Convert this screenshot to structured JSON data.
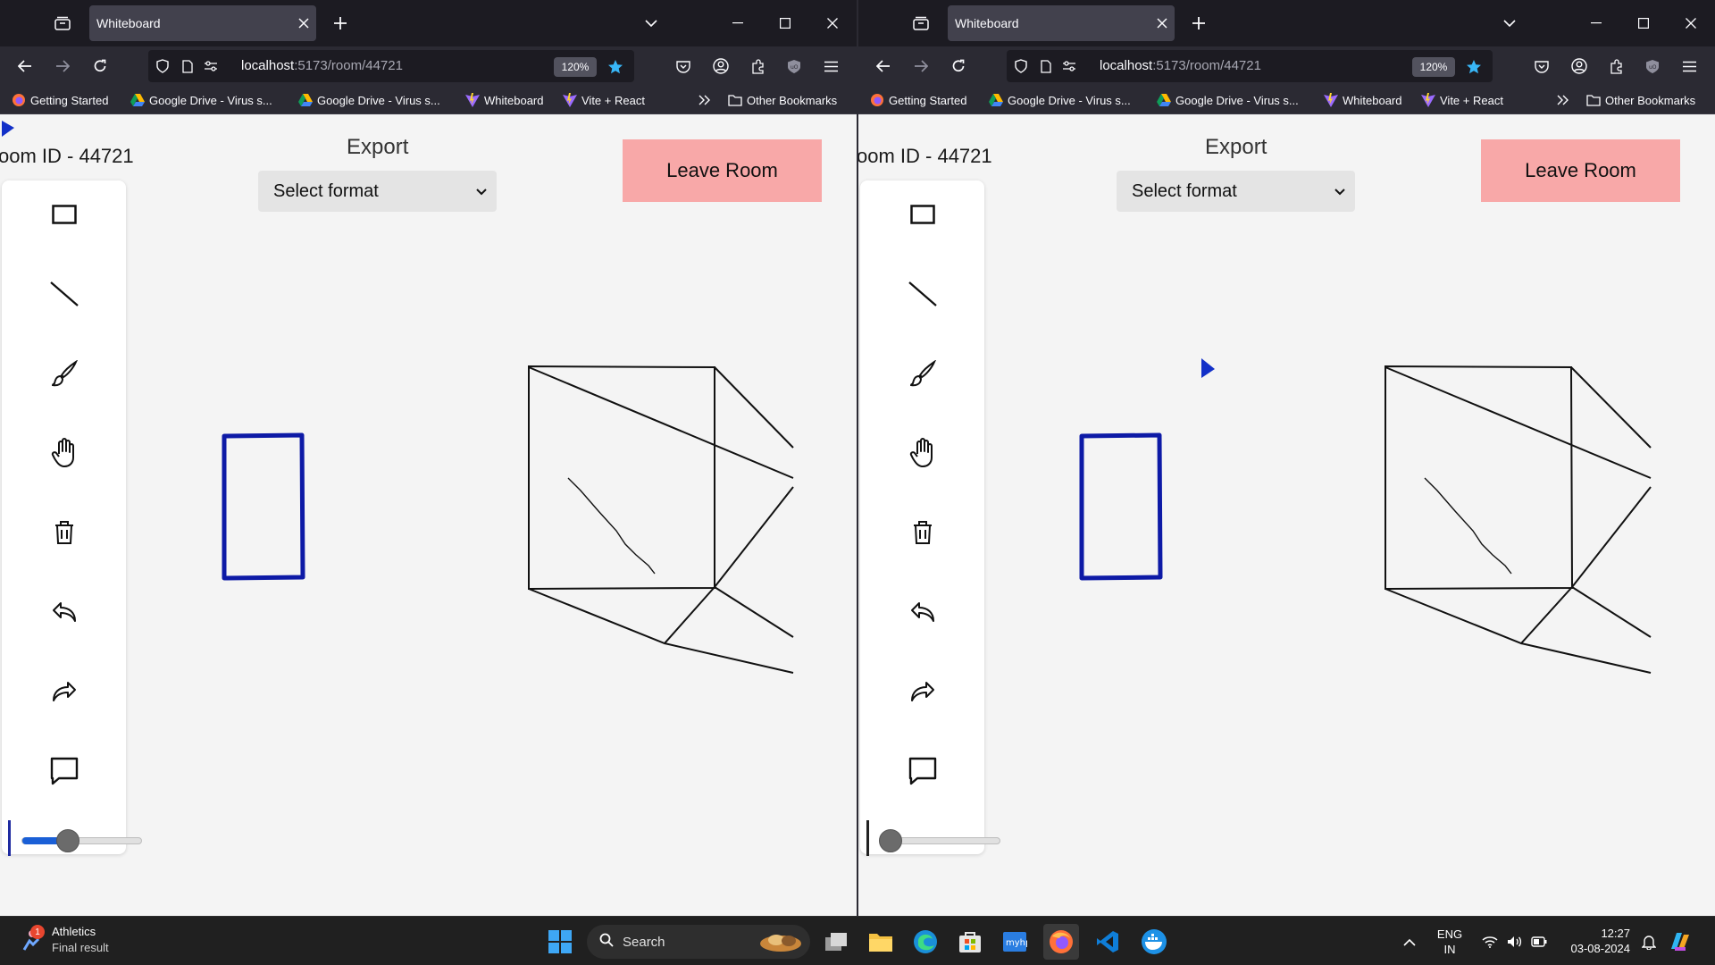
{
  "browser": {
    "tab_title": "Whiteboard",
    "url_host": "localhost",
    "url_path": ":5173/room/44721",
    "zoom": "120%",
    "bookmarks": [
      {
        "label": "Getting Started",
        "icon": "firefox-icon"
      },
      {
        "label": "Google Drive - Virus s...",
        "icon": "google-drive-icon"
      },
      {
        "label": "Google Drive - Virus s...",
        "icon": "google-drive-icon"
      },
      {
        "label": "Whiteboard",
        "icon": "vite-icon"
      },
      {
        "label": "Vite + React",
        "icon": "vite-icon"
      }
    ],
    "other_bookmarks": "Other Bookmarks"
  },
  "app": {
    "room_id": "oom ID - 44721",
    "export_label": "Export",
    "export_select": "Select format",
    "leave_button": "Leave Room",
    "tools": [
      "rectangle-tool",
      "line-tool",
      "brush-tool",
      "hand-tool",
      "delete-tool",
      "undo",
      "redo",
      "chat"
    ],
    "stroke_color": "#1e2aa0",
    "left_slider_fraction": 0.37,
    "right_slider_fraction": 0.0
  },
  "taskbar": {
    "widget_title": "Athletics",
    "widget_sub": "Final result",
    "widget_badge": "1",
    "search_placeholder": "Search",
    "lang_top": "ENG",
    "lang_bottom": "IN",
    "time": "12:27",
    "date": "03-08-2024"
  }
}
